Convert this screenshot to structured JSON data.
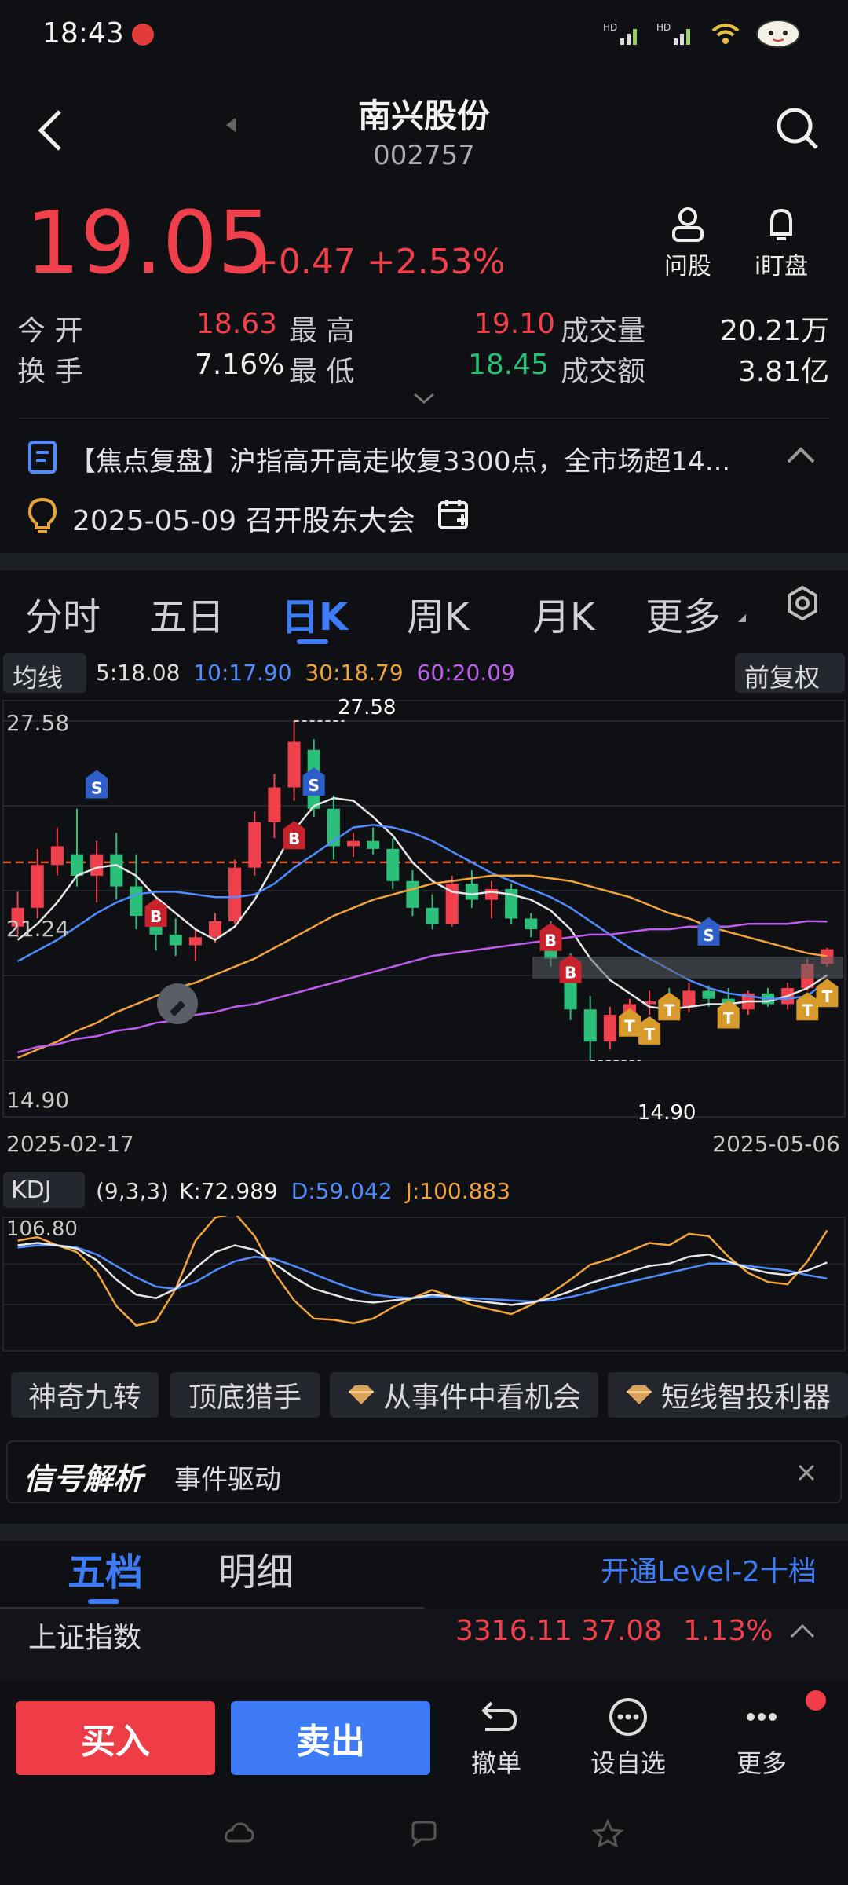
{
  "status_bar": {
    "time": "18:43"
  },
  "header": {
    "name": "南兴股份",
    "code": "002757"
  },
  "quote": {
    "price": "19.05",
    "change": "+0.47",
    "change_pct": "+2.53%",
    "actions": [
      {
        "label": "问股",
        "icon": "person-icon"
      },
      {
        "label": "i盯盘",
        "icon": "bell-icon"
      }
    ]
  },
  "stats": {
    "open_label": "今 开",
    "open": "18.63",
    "high_label": "最 高",
    "high": "19.10",
    "vol_label": "成交量",
    "vol": "20.21万",
    "turnover_label": "换 手",
    "turnover": "7.16%",
    "low_label": "最 低",
    "low": "18.45",
    "amount_label": "成交额",
    "amount": "3.81亿"
  },
  "news": {
    "headline": "【焦点复盘】沪指高开高走收复3300点，全市场超14...",
    "event": "2025-05-09 召开股东大会"
  },
  "chart_tabs": [
    "分时",
    "五日",
    "日K",
    "周K",
    "月K",
    "更多"
  ],
  "active_tab": "日K",
  "ma_bar": {
    "type_label": "均线",
    "ma5": "5:18.08",
    "ma10": "10:17.90",
    "ma30": "30:18.79",
    "ma60": "60:20.09",
    "adjust": "前复权"
  },
  "kline_labels": {
    "top": "27.58",
    "mid": "21.24",
    "bottom": "14.90",
    "start_date": "2025-02-17",
    "end_date": "2025-05-06",
    "max_annot": "27.58",
    "min_annot": "14.90"
  },
  "kdj": {
    "label": "KDJ",
    "params": "(9,3,3)",
    "k": "K:72.989",
    "d": "D:59.042",
    "j": "J:100.883",
    "top": "106.80"
  },
  "feature_chips": [
    "神奇九转",
    "顶底猎手",
    "从事件中看机会",
    "短线智投利器"
  ],
  "signal": {
    "logo": "信号解析",
    "text": "事件驱动"
  },
  "depth_tabs": {
    "five": "五档",
    "detail": "明细",
    "upgrade": "开通Level-2十档"
  },
  "index_ticker": {
    "name": "上证指数",
    "value": "3316.11",
    "change": "37.08",
    "pct": "1.13%"
  },
  "bottom_bar": {
    "buy": "买入",
    "sell": "卖出",
    "undo": "撤单",
    "watch": "设自选",
    "more": "更多"
  },
  "colors": {
    "up": "#f0404b",
    "down": "#2bbf7a",
    "accent": "#3d7bf7",
    "bg": "#0e1013"
  },
  "chart_data": {
    "type": "candlestick",
    "x_range": [
      "2025-02-17",
      "2025-05-06"
    ],
    "y_range": [
      14.9,
      27.58
    ],
    "ylim": [
      14.9,
      27.58
    ],
    "reference_price": 22.3,
    "candles": [
      {
        "o": 19.9,
        "h": 21.2,
        "l": 19.5,
        "c": 20.6
      },
      {
        "o": 20.6,
        "h": 22.8,
        "l": 20.2,
        "c": 22.2
      },
      {
        "o": 22.2,
        "h": 23.6,
        "l": 21.8,
        "c": 22.9
      },
      {
        "o": 22.6,
        "h": 24.3,
        "l": 21.4,
        "c": 21.8
      },
      {
        "o": 21.8,
        "h": 23.1,
        "l": 20.8,
        "c": 22.6
      },
      {
        "o": 22.6,
        "h": 23.4,
        "l": 20.9,
        "c": 21.4
      },
      {
        "o": 21.4,
        "h": 22.6,
        "l": 19.8,
        "c": 20.3
      },
      {
        "o": 20.3,
        "h": 20.9,
        "l": 19.0,
        "c": 19.6
      },
      {
        "o": 19.6,
        "h": 20.2,
        "l": 18.8,
        "c": 19.2
      },
      {
        "o": 19.2,
        "h": 19.8,
        "l": 18.6,
        "c": 19.5
      },
      {
        "o": 19.5,
        "h": 20.4,
        "l": 19.3,
        "c": 20.1
      },
      {
        "o": 20.1,
        "h": 22.4,
        "l": 20.0,
        "c": 22.1
      },
      {
        "o": 22.1,
        "h": 24.2,
        "l": 21.8,
        "c": 23.8
      },
      {
        "o": 23.8,
        "h": 25.6,
        "l": 23.2,
        "c": 25.1
      },
      {
        "o": 25.1,
        "h": 27.58,
        "l": 24.6,
        "c": 26.8
      },
      {
        "o": 26.5,
        "h": 26.9,
        "l": 24.0,
        "c": 24.3
      },
      {
        "o": 24.3,
        "h": 24.8,
        "l": 22.4,
        "c": 22.9
      },
      {
        "o": 22.9,
        "h": 23.4,
        "l": 22.5,
        "c": 23.1
      },
      {
        "o": 23.1,
        "h": 23.6,
        "l": 22.6,
        "c": 22.8
      },
      {
        "o": 22.8,
        "h": 23.2,
        "l": 21.3,
        "c": 21.6
      },
      {
        "o": 21.6,
        "h": 22.0,
        "l": 20.3,
        "c": 20.6
      },
      {
        "o": 20.6,
        "h": 21.1,
        "l": 19.8,
        "c": 20.0
      },
      {
        "o": 20.0,
        "h": 21.8,
        "l": 19.9,
        "c": 21.5
      },
      {
        "o": 21.5,
        "h": 22.0,
        "l": 20.6,
        "c": 20.9
      },
      {
        "o": 20.9,
        "h": 21.6,
        "l": 20.2,
        "c": 21.3
      },
      {
        "o": 21.3,
        "h": 21.5,
        "l": 20.0,
        "c": 20.2
      },
      {
        "o": 20.2,
        "h": 20.4,
        "l": 19.5,
        "c": 19.8
      },
      {
        "o": 19.8,
        "h": 20.1,
        "l": 18.4,
        "c": 18.7
      },
      {
        "o": 18.7,
        "h": 18.9,
        "l": 16.4,
        "c": 16.8
      },
      {
        "o": 16.8,
        "h": 17.3,
        "l": 14.9,
        "c": 15.6
      },
      {
        "o": 15.6,
        "h": 16.9,
        "l": 15.3,
        "c": 16.6
      },
      {
        "o": 16.6,
        "h": 17.2,
        "l": 16.2,
        "c": 17.0
      },
      {
        "o": 17.0,
        "h": 17.5,
        "l": 16.6,
        "c": 17.1
      },
      {
        "o": 17.1,
        "h": 17.6,
        "l": 16.5,
        "c": 16.9
      },
      {
        "o": 16.9,
        "h": 17.8,
        "l": 16.7,
        "c": 17.5
      },
      {
        "o": 17.5,
        "h": 17.7,
        "l": 16.9,
        "c": 17.2
      },
      {
        "o": 17.2,
        "h": 17.6,
        "l": 16.5,
        "c": 16.8
      },
      {
        "o": 16.8,
        "h": 17.5,
        "l": 16.6,
        "c": 17.4
      },
      {
        "o": 17.4,
        "h": 17.6,
        "l": 16.9,
        "c": 17.0
      },
      {
        "o": 17.0,
        "h": 17.8,
        "l": 16.8,
        "c": 17.6
      },
      {
        "o": 17.6,
        "h": 18.7,
        "l": 17.5,
        "c": 18.5
      },
      {
        "o": 18.5,
        "h": 19.1,
        "l": 18.4,
        "c": 19.05
      }
    ],
    "series": [
      {
        "name": "5",
        "values": [
          19.4,
          20.0,
          20.8,
          21.8,
          22.1,
          22.2,
          21.8,
          21.0,
          20.4,
          19.8,
          19.4,
          19.9,
          20.9,
          22.2,
          23.5,
          24.4,
          24.7,
          24.6,
          24.0,
          23.3,
          22.3,
          21.6,
          21.2,
          21.1,
          21.2,
          21.1,
          20.9,
          20.5,
          19.8,
          18.7,
          17.9,
          17.4,
          16.9,
          16.8,
          16.9,
          17.0,
          17.0,
          17.1,
          17.1,
          17.3,
          17.6,
          18.08
        ]
      },
      {
        "name": "10",
        "values": [
          18.6,
          19.0,
          19.4,
          19.9,
          20.4,
          20.8,
          21.1,
          21.2,
          21.2,
          21.1,
          21.0,
          21.0,
          21.1,
          21.5,
          22.1,
          22.6,
          23.1,
          23.6,
          23.7,
          23.6,
          23.4,
          23.1,
          22.7,
          22.3,
          21.9,
          21.6,
          21.3,
          21.0,
          20.6,
          20.1,
          19.6,
          19.1,
          18.7,
          18.3,
          17.9,
          17.6,
          17.4,
          17.3,
          17.2,
          17.2,
          17.3,
          17.9
        ]
      },
      {
        "name": "30",
        "values": [
          15.0,
          15.3,
          15.6,
          16.0,
          16.3,
          16.7,
          17.0,
          17.3,
          17.6,
          17.8,
          18.1,
          18.4,
          18.7,
          19.1,
          19.5,
          19.9,
          20.3,
          20.6,
          20.9,
          21.1,
          21.3,
          21.5,
          21.6,
          21.7,
          21.8,
          21.8,
          21.8,
          21.7,
          21.6,
          21.4,
          21.2,
          21.0,
          20.7,
          20.4,
          20.2,
          19.9,
          19.7,
          19.5,
          19.3,
          19.1,
          18.9,
          18.79
        ]
      },
      {
        "name": "60",
        "values": [
          15.2,
          15.4,
          15.5,
          15.7,
          15.8,
          16.0,
          16.1,
          16.3,
          16.4,
          16.6,
          16.7,
          16.9,
          17.0,
          17.2,
          17.4,
          17.6,
          17.8,
          18.0,
          18.2,
          18.4,
          18.6,
          18.8,
          18.9,
          19.0,
          19.1,
          19.2,
          19.3,
          19.4,
          19.5,
          19.6,
          19.6,
          19.7,
          19.8,
          19.8,
          19.9,
          19.9,
          19.9,
          20.0,
          20.0,
          20.0,
          20.1,
          20.09
        ]
      }
    ],
    "kdj": {
      "K": [
        88,
        90,
        88,
        85,
        75,
        58,
        45,
        42,
        50,
        68,
        82,
        88,
        84,
        72,
        60,
        50,
        45,
        40,
        38,
        40,
        42,
        45,
        43,
        40,
        38,
        36,
        38,
        42,
        48,
        55,
        60,
        65,
        70,
        72,
        78,
        80,
        74,
        68,
        64,
        62,
        66,
        72.989
      ],
      "D": [
        86,
        88,
        88,
        86,
        80,
        70,
        60,
        52,
        50,
        56,
        66,
        74,
        78,
        76,
        70,
        63,
        56,
        50,
        45,
        43,
        42,
        43,
        43,
        42,
        41,
        40,
        39,
        40,
        43,
        47,
        52,
        56,
        60,
        64,
        68,
        72,
        72,
        70,
        68,
        66,
        62,
        59.042
      ],
      "J": [
        92,
        95,
        88,
        82,
        65,
        35,
        18,
        22,
        50,
        92,
        112,
        116,
        96,
        64,
        40,
        24,
        23,
        20,
        24,
        34,
        42,
        49,
        43,
        36,
        32,
        28,
        36,
        46,
        58,
        71,
        76,
        83,
        90,
        88,
        98,
        96,
        78,
        64,
        56,
        54,
        74,
        100.883
      ]
    },
    "kdj_ylim": [
      0,
      106.8
    ]
  }
}
